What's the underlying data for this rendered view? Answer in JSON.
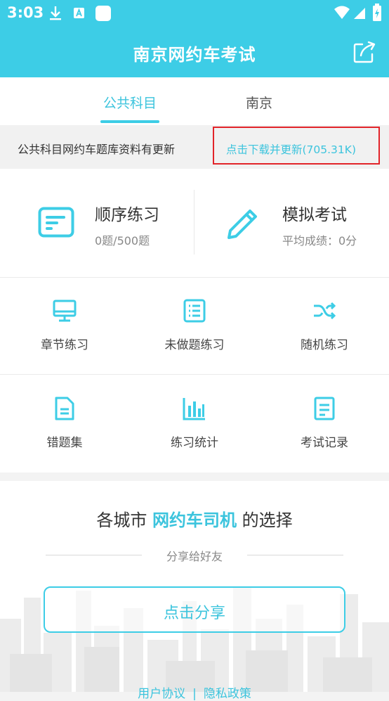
{
  "status": {
    "time": "3:03"
  },
  "header": {
    "title": "南京网约车考试",
    "share_icon": "share-icon"
  },
  "tabs": [
    {
      "label": "公共科目",
      "active": true
    },
    {
      "label": "南京",
      "active": false
    }
  ],
  "notice": {
    "text": "公共科目网约车题库资料有更新",
    "link": "点击下载并更新(705.31K)"
  },
  "main_cards": [
    {
      "title": "顺序练习",
      "subtitle": "0题/500题",
      "icon": "list-card-icon"
    },
    {
      "title": "模拟考试",
      "subtitle": "平均成绩：0分",
      "icon": "pencil-icon"
    }
  ],
  "grid": [
    {
      "label": "章节练习",
      "icon": "monitor-icon"
    },
    {
      "label": "未做题练习",
      "icon": "list-doc-icon"
    },
    {
      "label": "随机练习",
      "icon": "shuffle-icon"
    },
    {
      "label": "错题集",
      "icon": "document-icon"
    },
    {
      "label": "练习统计",
      "icon": "bar-chart-icon"
    },
    {
      "label": "考试记录",
      "icon": "record-icon"
    }
  ],
  "promo": {
    "title_prefix": "各城市",
    "title_highlight": "网约车司机",
    "title_suffix": "的选择",
    "subtitle": "分享给好友",
    "button": "点击分享"
  },
  "footer": {
    "agreement": "用户协议",
    "separator": "|",
    "privacy": "隐私政策"
  },
  "colors": {
    "accent": "#3dcde6",
    "highlight_box": "#e2242a"
  }
}
